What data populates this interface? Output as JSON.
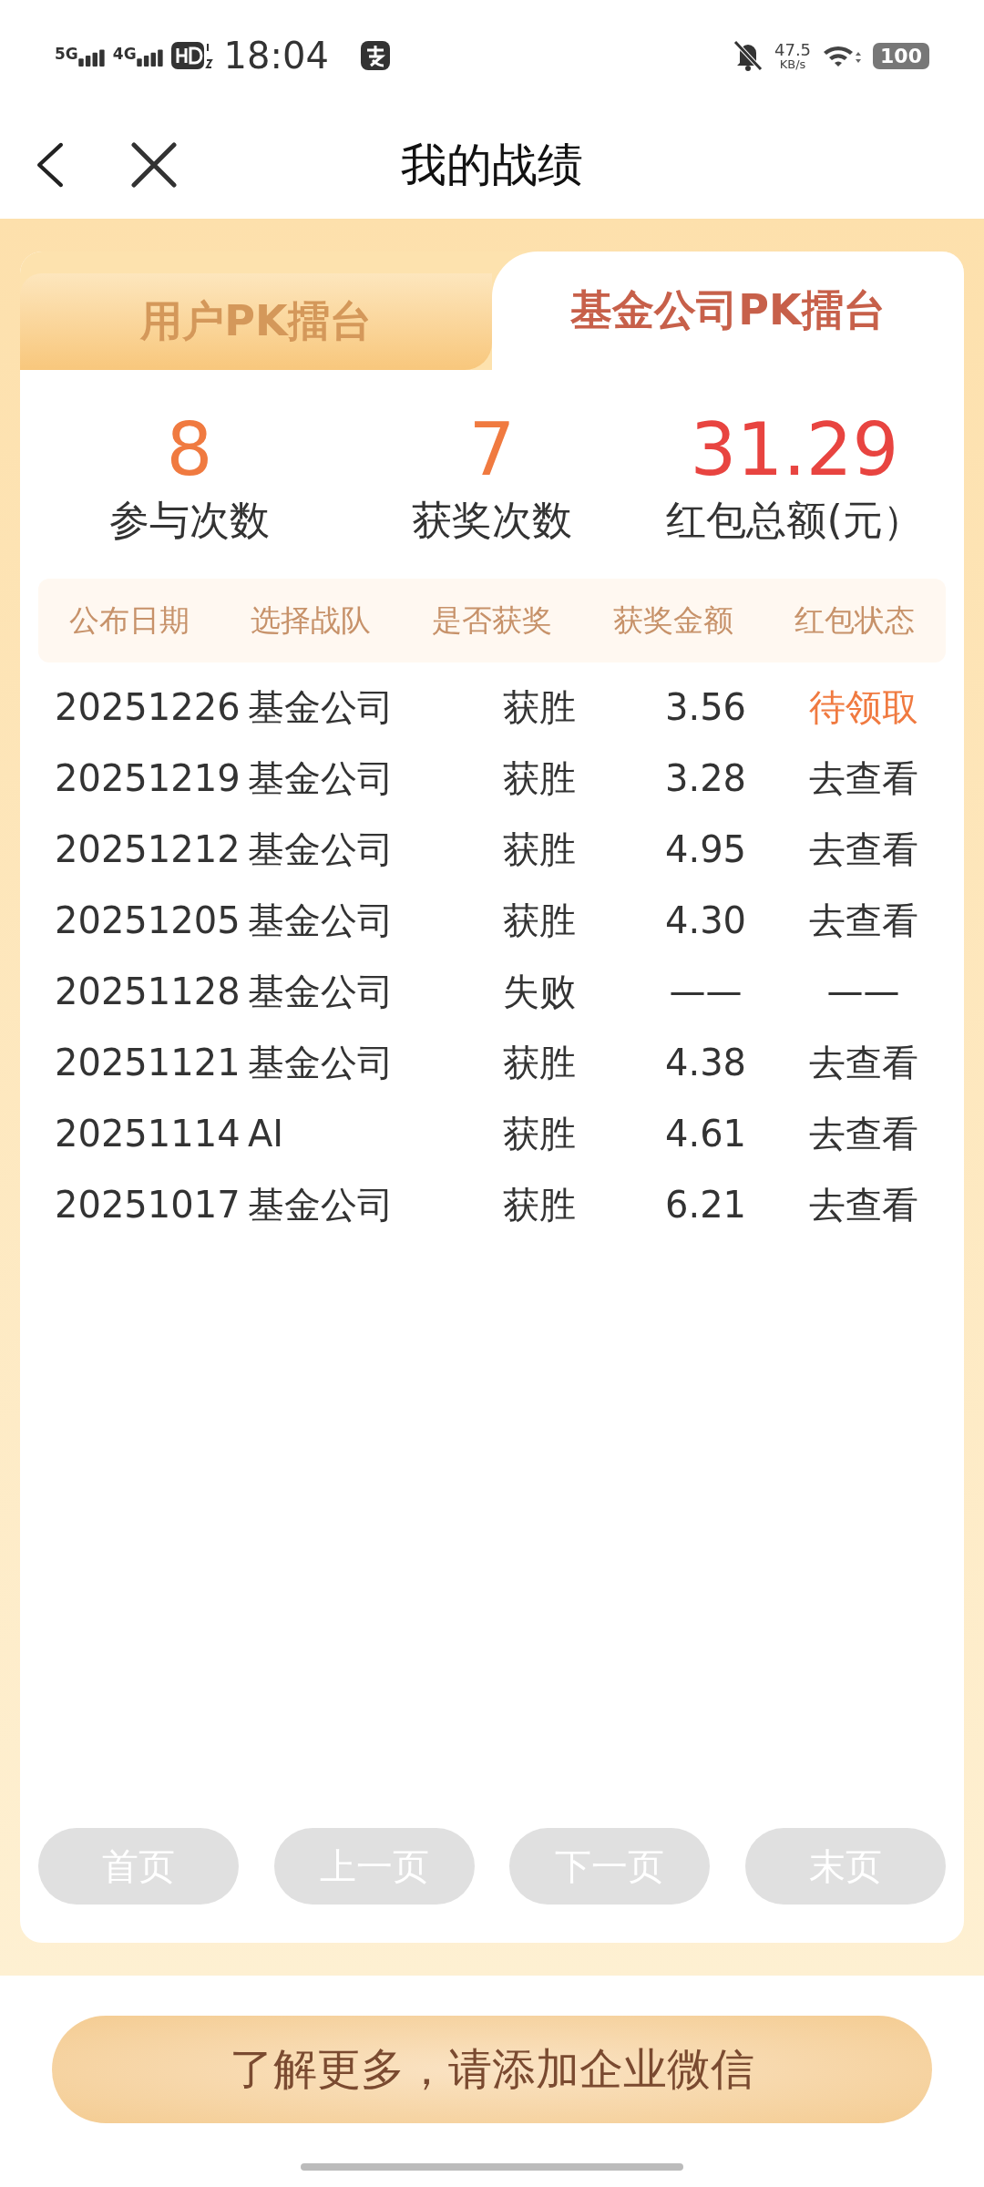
{
  "status_bar": {
    "network_1": "5G",
    "network_2": "4G",
    "time": "18:04",
    "speed_value": "47.5",
    "speed_unit": "KB/s",
    "battery": "100"
  },
  "header": {
    "title": "我的战绩"
  },
  "tabs": [
    {
      "label": "用户PK擂台",
      "selected": false
    },
    {
      "label": "基金公司PK擂台",
      "selected": true
    }
  ],
  "stats": [
    {
      "value": "8",
      "label": "参与次数",
      "kind": "count"
    },
    {
      "value": "7",
      "label": "获奖次数",
      "kind": "count"
    },
    {
      "value": "31.29",
      "label": "红包总额(元）",
      "kind": "money"
    }
  ],
  "table": {
    "columns": [
      "公布日期",
      "选择战队",
      "是否获奖",
      "获奖金额",
      "红包状态"
    ],
    "rows": [
      {
        "date": "20251226",
        "team": "基金公司",
        "result": "获胜",
        "amount": "3.56",
        "status": "待领取",
        "status_pending": true
      },
      {
        "date": "20251219",
        "team": "基金公司",
        "result": "获胜",
        "amount": "3.28",
        "status": "去查看",
        "status_pending": false
      },
      {
        "date": "20251212",
        "team": "基金公司",
        "result": "获胜",
        "amount": "4.95",
        "status": "去查看",
        "status_pending": false
      },
      {
        "date": "20251205",
        "team": "基金公司",
        "result": "获胜",
        "amount": "4.30",
        "status": "去查看",
        "status_pending": false
      },
      {
        "date": "20251128",
        "team": "基金公司",
        "result": "失败",
        "amount": "——",
        "status": "——",
        "status_pending": false
      },
      {
        "date": "20251121",
        "team": "基金公司",
        "result": "获胜",
        "amount": "4.38",
        "status": "去查看",
        "status_pending": false
      },
      {
        "date": "20251114",
        "team": "AI",
        "result": "获胜",
        "amount": "4.61",
        "status": "去查看",
        "status_pending": false
      },
      {
        "date": "20251017",
        "team": "基金公司",
        "result": "获胜",
        "amount": "6.21",
        "status": "去查看",
        "status_pending": false
      }
    ]
  },
  "pagination": [
    {
      "label": "首页",
      "disabled": true
    },
    {
      "label": "上一页",
      "disabled": true
    },
    {
      "label": "下一页",
      "disabled": true
    },
    {
      "label": "末页",
      "disabled": true
    }
  ],
  "footer_button": {
    "label": "了解更多，请添加企业微信"
  }
}
